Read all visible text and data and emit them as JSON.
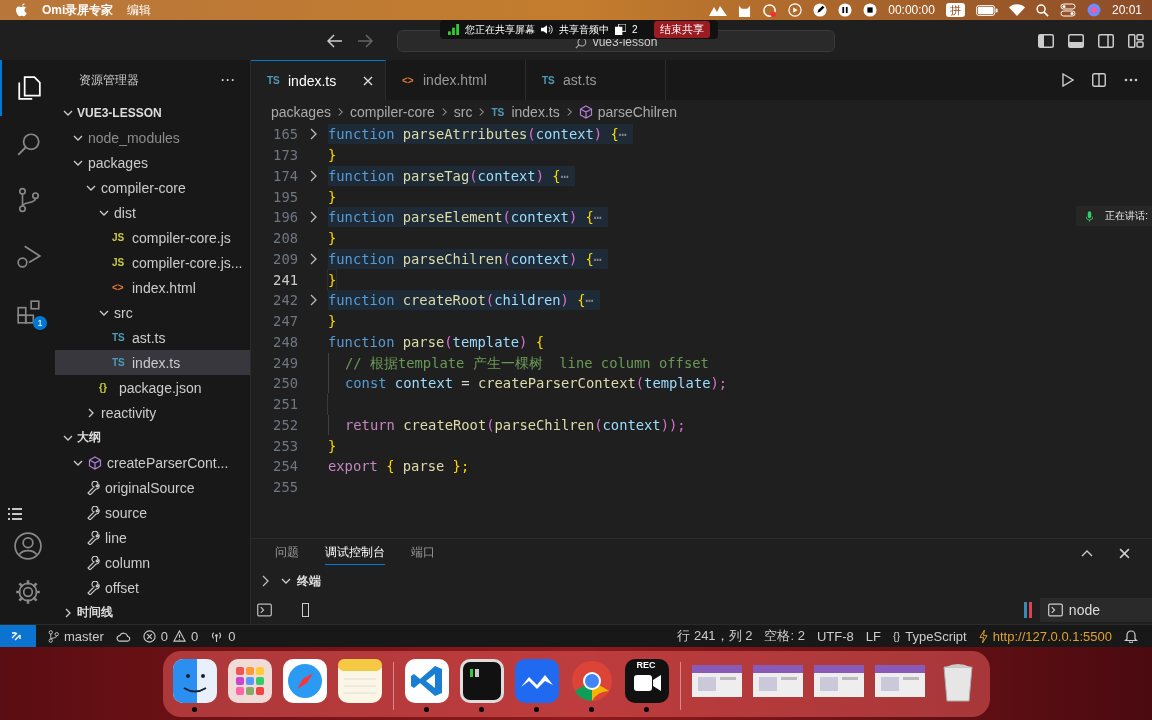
{
  "menubar": {
    "app": "Omi录屏专家",
    "menus": [
      "编辑"
    ],
    "timer": "00:00:00",
    "input_method": "拼",
    "clock": "20:01"
  },
  "sharing": {
    "status": "您正在共享屏幕",
    "audio": "共享音频中",
    "windows": "2",
    "stop": "结束共享"
  },
  "window": {
    "title": "vue3-lesson"
  },
  "activity": [
    {
      "kind": "files",
      "selected": true
    },
    {
      "kind": "search",
      "selected": false
    },
    {
      "kind": "scm",
      "selected": false
    },
    {
      "kind": "debug",
      "selected": false
    },
    {
      "kind": "extensions",
      "selected": false,
      "badge": "1"
    }
  ],
  "sidebar": {
    "title": "资源管理器",
    "more": "···",
    "sections": [
      {
        "title": "VUE3-LESSON",
        "expanded": true,
        "items": [
          {
            "label": "node_modules",
            "kind": "folder",
            "expanded": true,
            "dimmed": true,
            "selected": false
          },
          {
            "label": "packages",
            "kind": "folder",
            "expanded": true,
            "dimmed": false,
            "selected": false,
            "children": [
              {
                "label": "compiler-core",
                "kind": "folder",
                "expanded": true,
                "dimmed": false,
                "selected": false,
                "children": [
                  {
                    "label": "dist",
                    "kind": "folder",
                    "expanded": true,
                    "dimmed": false,
                    "selected": false,
                    "children": [
                      {
                        "label": "compiler-core.js",
                        "kind": "file",
                        "icon": "JS",
                        "color": "#cbcb41",
                        "dimmed": false,
                        "selected": false
                      },
                      {
                        "label": "compiler-core.js...",
                        "kind": "file",
                        "icon": "JS",
                        "color": "#cbcb41",
                        "dimmed": false,
                        "selected": false
                      },
                      {
                        "label": "index.html",
                        "kind": "file",
                        "icon": "<>",
                        "color": "#e37933",
                        "dimmed": false,
                        "selected": false
                      }
                    ]
                  },
                  {
                    "label": "src",
                    "kind": "folder",
                    "expanded": true,
                    "dimmed": false,
                    "selected": false,
                    "children": [
                      {
                        "label": "ast.ts",
                        "kind": "file",
                        "icon": "TS",
                        "color": "#519aba",
                        "dimmed": false,
                        "selected": false
                      },
                      {
                        "label": "index.ts",
                        "kind": "file",
                        "icon": "TS",
                        "color": "#519aba",
                        "dimmed": false,
                        "selected": true
                      }
                    ]
                  },
                  {
                    "label": "package.json",
                    "kind": "file",
                    "icon": "{}",
                    "color": "#cbcb41",
                    "dimmed": false,
                    "selected": false
                  }
                ]
              },
              {
                "label": "reactivity",
                "kind": "folder",
                "expanded": false,
                "dimmed": false,
                "selected": false
              }
            ]
          }
        ]
      },
      {
        "title": "大纲",
        "expanded": true,
        "items": [
          {
            "label": "createParserCont...",
            "kind": "class",
            "expanded": true,
            "dimmed": false,
            "selected": false,
            "children": [
              {
                "label": "originalSource",
                "kind": "property",
                "dimmed": false,
                "selected": false
              },
              {
                "label": "source",
                "kind": "property",
                "dimmed": false,
                "selected": false
              },
              {
                "label": "line",
                "kind": "property",
                "dimmed": false,
                "selected": false
              },
              {
                "label": "column",
                "kind": "property",
                "dimmed": false,
                "selected": false
              },
              {
                "label": "offset",
                "kind": "property",
                "dimmed": false,
                "selected": false
              }
            ]
          }
        ]
      },
      {
        "title": "时间线",
        "expanded": false
      }
    ]
  },
  "tabs": [
    {
      "label": "index.ts",
      "icon": "TS",
      "color": "#519aba",
      "selected": true
    },
    {
      "label": "index.html",
      "icon": "<>",
      "color": "#e37933",
      "selected": false
    },
    {
      "label": "ast.ts",
      "icon": "TS",
      "color": "#519aba",
      "selected": false
    }
  ],
  "breadcrumbs": [
    {
      "label": "packages",
      "kind": "folder"
    },
    {
      "label": "compiler-core",
      "kind": "folder"
    },
    {
      "label": "src",
      "kind": "folder"
    },
    {
      "label": "index.ts",
      "kind": "file",
      "icon": "TS"
    },
    {
      "label": "parseChilren",
      "kind": "symbol"
    }
  ],
  "code": [
    {
      "number": "165",
      "folded": true,
      "current": false,
      "indented": false,
      "tokens": [
        {
          "t": "function",
          "kind": "kw"
        },
        {
          "t": "parseAtrributes",
          "kind": "fn"
        },
        {
          "t": "(",
          "kind": "pn"
        },
        {
          "t": "context",
          "kind": "var"
        },
        {
          "t": ")",
          "kind": "pn"
        },
        {
          "t": "{",
          "kind": "br"
        },
        {
          "t": "⋯",
          "kind": "ell"
        }
      ]
    },
    {
      "number": "173",
      "folded": false,
      "current": false,
      "indented": false,
      "tokens": [
        {
          "t": "}",
          "kind": "br"
        }
      ]
    },
    {
      "number": "174",
      "folded": true,
      "current": false,
      "indented": false,
      "tokens": [
        {
          "t": "function",
          "kind": "kw"
        },
        {
          "t": "parseTag",
          "kind": "fn"
        },
        {
          "t": "(",
          "kind": "pn"
        },
        {
          "t": "context",
          "kind": "var"
        },
        {
          "t": ")",
          "kind": "pn"
        },
        {
          "t": "{",
          "kind": "br"
        },
        {
          "t": "⋯",
          "kind": "ell"
        }
      ]
    },
    {
      "number": "195",
      "folded": false,
      "current": false,
      "indented": false,
      "tokens": [
        {
          "t": "}",
          "kind": "br"
        }
      ]
    },
    {
      "number": "196",
      "folded": true,
      "current": false,
      "indented": false,
      "tokens": [
        {
          "t": "function",
          "kind": "kw"
        },
        {
          "t": "parseElement",
          "kind": "fn"
        },
        {
          "t": "(",
          "kind": "pn"
        },
        {
          "t": "context",
          "kind": "var"
        },
        {
          "t": ")",
          "kind": "pn"
        },
        {
          "t": "{",
          "kind": "br"
        },
        {
          "t": "⋯",
          "kind": "ell"
        }
      ]
    },
    {
      "number": "208",
      "folded": false,
      "current": false,
      "indented": false,
      "tokens": [
        {
          "t": "}",
          "kind": "br"
        }
      ]
    },
    {
      "number": "209",
      "folded": true,
      "current": false,
      "indented": false,
      "tokens": [
        {
          "t": "function",
          "kind": "kw"
        },
        {
          "t": "parseChilren",
          "kind": "fn"
        },
        {
          "t": "(",
          "kind": "pn"
        },
        {
          "t": "context",
          "kind": "var"
        },
        {
          "t": ")",
          "kind": "pn"
        },
        {
          "t": "{",
          "kind": "br"
        },
        {
          "t": "⋯",
          "kind": "ell"
        }
      ]
    },
    {
      "number": "241",
      "folded": false,
      "current": true,
      "indented": false,
      "tokens": [
        {
          "t": "}",
          "kind": "br"
        }
      ]
    },
    {
      "number": "242",
      "folded": true,
      "current": false,
      "indented": false,
      "tokens": [
        {
          "t": "function",
          "kind": "kw"
        },
        {
          "t": "createRoot",
          "kind": "fn"
        },
        {
          "t": "(",
          "kind": "pn"
        },
        {
          "t": "children",
          "kind": "var"
        },
        {
          "t": ")",
          "kind": "pn"
        },
        {
          "t": "{",
          "kind": "br"
        },
        {
          "t": "⋯",
          "kind": "ell"
        }
      ]
    },
    {
      "number": "247",
      "folded": false,
      "current": false,
      "indented": false,
      "tokens": [
        {
          "t": "}",
          "kind": "br"
        }
      ]
    },
    {
      "number": "248",
      "folded": false,
      "current": false,
      "indented": false,
      "tokens": [
        {
          "t": "function",
          "kind": "kw"
        },
        {
          "t": "parse",
          "kind": "fn"
        },
        {
          "t": "(",
          "kind": "pn"
        },
        {
          "t": "template",
          "kind": "var"
        },
        {
          "t": ")",
          "kind": "pn"
        },
        {
          "t": "{",
          "kind": "br"
        }
      ]
    },
    {
      "number": "249",
      "folded": false,
      "current": false,
      "indented": true,
      "tokens": [
        {
          "t": "// 根据template 产生一棵树  line column offset",
          "kind": "cm"
        }
      ]
    },
    {
      "number": "250",
      "folded": false,
      "current": false,
      "indented": true,
      "tokens": [
        {
          "t": "const",
          "kind": "kw"
        },
        {
          "t": "context",
          "kind": "var"
        },
        {
          "t": "=",
          "kind": "pl"
        },
        {
          "t": "createParserContext",
          "kind": "fn"
        },
        {
          "t": "(",
          "kind": "pn"
        },
        {
          "t": "template",
          "kind": "var"
        },
        {
          "t": ");",
          "kind": "pn"
        }
      ]
    },
    {
      "number": "251",
      "folded": false,
      "current": false,
      "indented": true
    },
    {
      "number": "252",
      "folded": false,
      "current": false,
      "indented": true,
      "tokens": [
        {
          "t": "return",
          "kind": "ctl"
        },
        {
          "t": "createRoot",
          "kind": "fn"
        },
        {
          "t": "(",
          "kind": "pn"
        },
        {
          "t": "parseChilren",
          "kind": "fn"
        },
        {
          "t": "(",
          "kind": "pn"
        },
        {
          "t": "context",
          "kind": "var"
        },
        {
          "t": "));",
          "kind": "pn"
        }
      ]
    },
    {
      "number": "253",
      "folded": false,
      "current": false,
      "indented": false,
      "tokens": [
        {
          "t": "}",
          "kind": "br"
        }
      ]
    },
    {
      "number": "254",
      "folded": false,
      "current": false,
      "indented": false,
      "tokens": [
        {
          "t": "export",
          "kind": "ctl"
        },
        {
          "t": "{",
          "kind": "br"
        },
        {
          "t": "parse",
          "kind": "fn"
        },
        {
          "t": "};",
          "kind": "br"
        }
      ]
    },
    {
      "number": "255",
      "folded": false,
      "current": false
    }
  ],
  "speaking": "正在讲话:",
  "panel": {
    "tabs": [
      {
        "label": "问题",
        "selected": false
      },
      {
        "label": "调试控制台",
        "selected": true
      },
      {
        "label": "端口",
        "selected": false
      }
    ],
    "terminal_title": "终端",
    "terminal_name": "node"
  },
  "status": {
    "branch": "master",
    "errors": "0",
    "warnings": "0",
    "ports": "0",
    "position": "行 241，列 2",
    "indent": "空格: 2",
    "encoding": "UTF-8",
    "eol": "LF",
    "lang_icon": "{}",
    "language": "TypeScript",
    "server": "http://127.0.0.1:5500"
  },
  "dock": [
    {
      "kind": "finder",
      "running": true
    },
    {
      "kind": "launchpad",
      "running": false
    },
    {
      "kind": "safari",
      "running": false
    },
    {
      "kind": "notes",
      "running": false
    },
    {
      "kind": "divider"
    },
    {
      "kind": "vscode",
      "running": true
    },
    {
      "kind": "terminal",
      "running": true
    },
    {
      "kind": "lark",
      "running": true
    },
    {
      "kind": "chrome",
      "running": true
    },
    {
      "kind": "recorder",
      "running": true,
      "badge": "REC"
    },
    {
      "kind": "divider"
    },
    {
      "kind": "thumb",
      "running": false
    },
    {
      "kind": "thumb",
      "running": false
    },
    {
      "kind": "thumb",
      "running": false
    },
    {
      "kind": "thumb",
      "running": false
    },
    {
      "kind": "trash",
      "running": false
    }
  ]
}
